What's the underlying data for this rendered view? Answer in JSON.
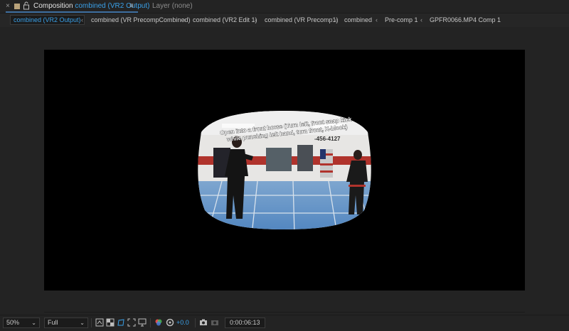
{
  "header": {
    "title_prefix": "Composition",
    "title_comp": "combined (VR2 Output)",
    "layer_tab": "Layer (none)"
  },
  "breadcrumbs": [
    "combined (VR2 Output)",
    "combined (VR PrecompCombined)",
    "combined (VR2 Edit 1)",
    "combined (VR Precomp1)",
    "combined",
    "Pre-comp 1",
    "GPFR0066.MP4 Comp 1"
  ],
  "video": {
    "overlay_line1": "Open into a front horse (Turn left, front snap kick",
    "overlay_line2": "while punching left hand, turn front, X-block)",
    "phone_text": "-456-4127"
  },
  "footer": {
    "zoom": "50%",
    "resolution": "Full",
    "exposure": "+0.0",
    "timecode": "0:00:06:13"
  },
  "colors": {
    "accent": "#3aa0e8",
    "panel_bg": "#232323",
    "canvas_bg": "#000000"
  }
}
